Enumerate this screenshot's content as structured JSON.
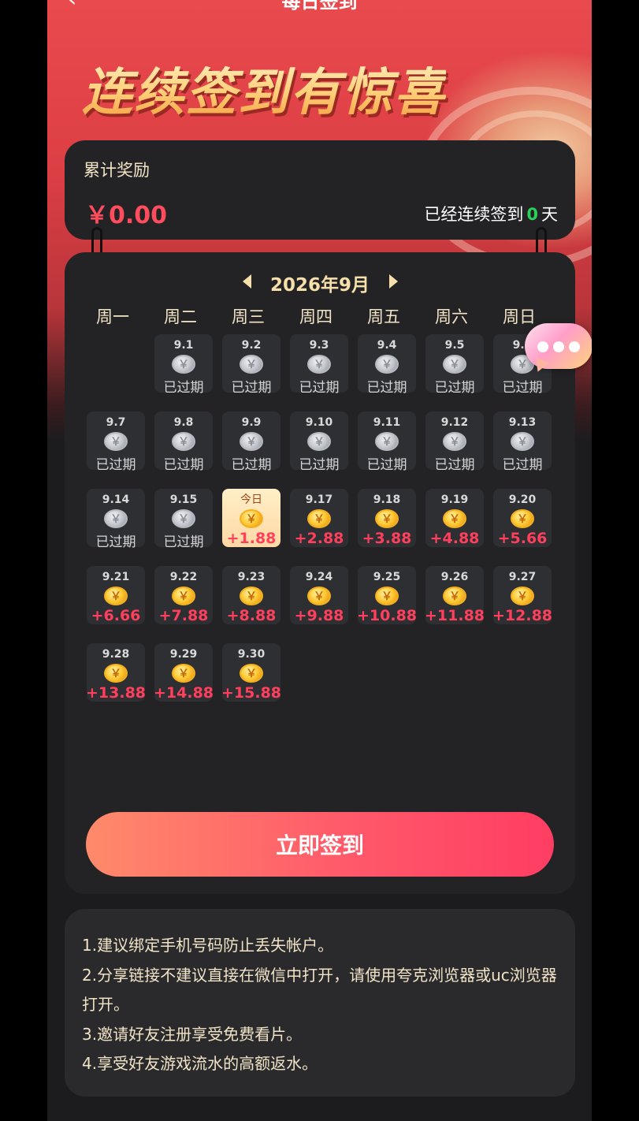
{
  "header": {
    "title": "每日签到",
    "back_icon": "chevron-left-icon"
  },
  "hero": {
    "headline": "连续签到有惊喜"
  },
  "reward_card": {
    "label": "累计奖励",
    "amount": "￥0.00",
    "streak_prefix": "已经连续签到",
    "streak_days": "0",
    "streak_suffix": "天"
  },
  "calendar": {
    "month_label": "2026年9月",
    "weekdays": [
      "周一",
      "周二",
      "周三",
      "周四",
      "周五",
      "周六",
      "周日"
    ],
    "leading_empty": 1,
    "days": [
      {
        "date": "9.1",
        "state": "expired",
        "status": "已过期"
      },
      {
        "date": "9.2",
        "state": "expired",
        "status": "已过期"
      },
      {
        "date": "9.3",
        "state": "expired",
        "status": "已过期"
      },
      {
        "date": "9.4",
        "state": "expired",
        "status": "已过期"
      },
      {
        "date": "9.5",
        "state": "expired",
        "status": "已过期"
      },
      {
        "date": "9.6",
        "state": "expired",
        "status": "已过期"
      },
      {
        "date": "9.7",
        "state": "expired",
        "status": "已过期"
      },
      {
        "date": "9.8",
        "state": "expired",
        "status": "已过期"
      },
      {
        "date": "9.9",
        "state": "expired",
        "status": "已过期"
      },
      {
        "date": "9.10",
        "state": "expired",
        "status": "已过期"
      },
      {
        "date": "9.11",
        "state": "expired",
        "status": "已过期"
      },
      {
        "date": "9.12",
        "state": "expired",
        "status": "已过期"
      },
      {
        "date": "9.13",
        "state": "expired",
        "status": "已过期"
      },
      {
        "date": "9.14",
        "state": "expired",
        "status": "已过期"
      },
      {
        "date": "9.15",
        "state": "expired",
        "status": "已过期"
      },
      {
        "date": "今日",
        "state": "today",
        "status": "+1.88"
      },
      {
        "date": "9.17",
        "state": "upcoming",
        "status": "+2.88"
      },
      {
        "date": "9.18",
        "state": "upcoming",
        "status": "+3.88"
      },
      {
        "date": "9.19",
        "state": "upcoming",
        "status": "+4.88"
      },
      {
        "date": "9.20",
        "state": "upcoming",
        "status": "+5.66"
      },
      {
        "date": "9.21",
        "state": "upcoming",
        "status": "+6.66"
      },
      {
        "date": "9.22",
        "state": "upcoming",
        "status": "+7.88"
      },
      {
        "date": "9.23",
        "state": "upcoming",
        "status": "+8.88"
      },
      {
        "date": "9.24",
        "state": "upcoming",
        "status": "+9.88"
      },
      {
        "date": "9.25",
        "state": "upcoming",
        "status": "+10.88"
      },
      {
        "date": "9.26",
        "state": "upcoming",
        "status": "+11.88"
      },
      {
        "date": "9.27",
        "state": "upcoming",
        "status": "+12.88"
      },
      {
        "date": "9.28",
        "state": "upcoming",
        "status": "+13.88"
      },
      {
        "date": "9.29",
        "state": "upcoming",
        "status": "+14.88"
      },
      {
        "date": "9.30",
        "state": "upcoming",
        "status": "+15.88"
      }
    ],
    "coin_glyph": "￥"
  },
  "actions": {
    "signin_label": "立即签到"
  },
  "notes": [
    "1.建议绑定手机号码防止丢失帐户。",
    "2.分享链接不建议直接在微信中打开，请使用夸克浏览器或uc浏览器打开。",
    "3.邀请好友注册享受免费看片。",
    "4.享受好友游戏流水的高额返水。"
  ],
  "colors": {
    "accent_red": "#ff3f5c",
    "streak_green": "#2ad15a",
    "gold": "#ffc933",
    "card_bg": "#232326"
  }
}
